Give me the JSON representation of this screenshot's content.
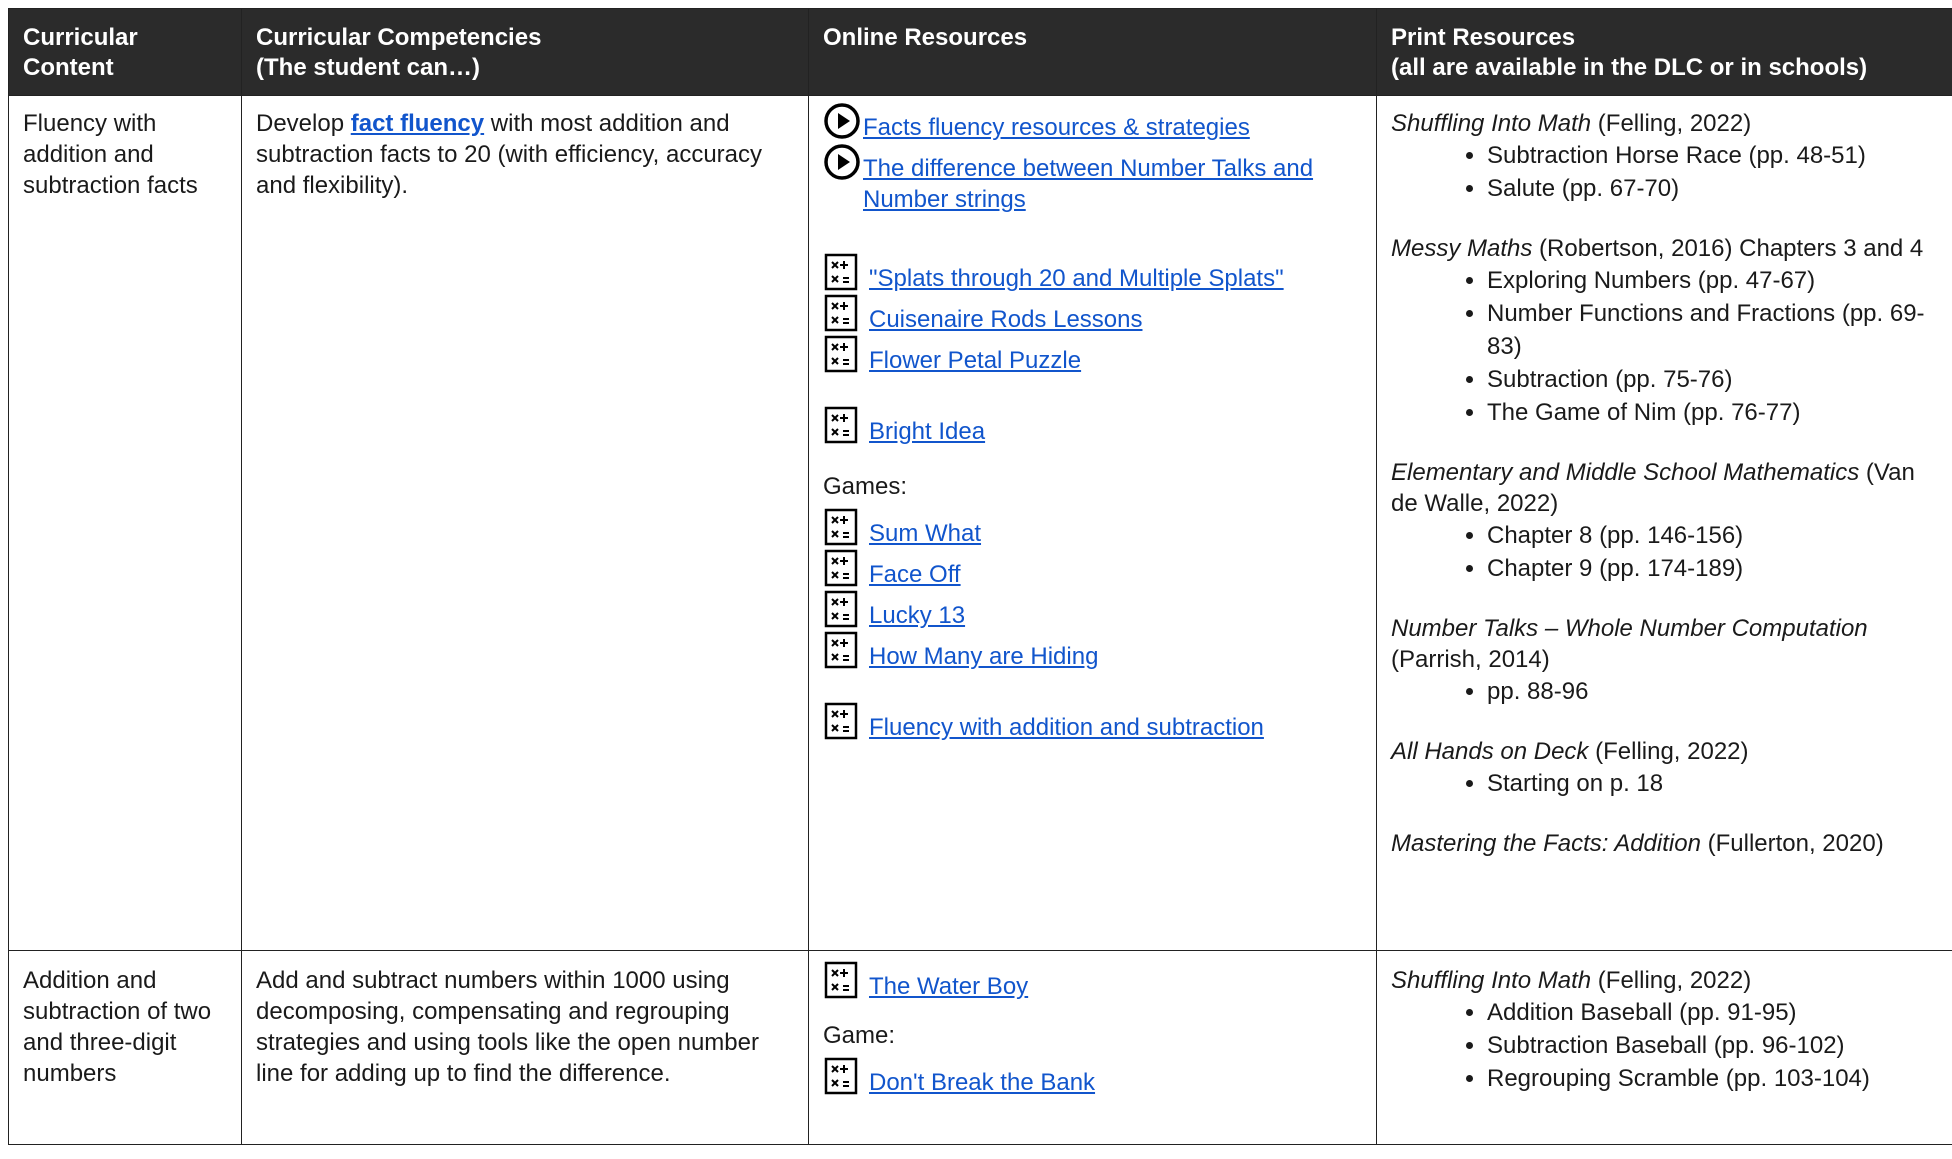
{
  "headers": {
    "content": "Curricular Content",
    "competencies": "Curricular Competencies\n (The student can…)",
    "online": "Online Resources",
    "print": "Print Resources\n (all are available in the DLC or in schools)"
  },
  "rows": [
    {
      "content": "Fluency with addition and subtraction facts",
      "competency_pre": "Develop ",
      "competency_link": "fact fluency",
      "competency_post": "  with most addition and subtraction facts to 20 (with efficiency, accuracy and flexibility).",
      "video_links": [
        "Facts fluency resources & strategies",
        "The difference between Number Talks and Number strings"
      ],
      "resource_links_a": [
        "\"Splats through 20 and Multiple Splats\"",
        "Cuisenaire Rods Lessons",
        "Flower Petal Puzzle"
      ],
      "resource_link_b": "Bright Idea",
      "games_label": "Games:",
      "game_links": [
        "Sum What",
        "Face Off",
        "Lucky 13",
        "How Many are Hiding"
      ],
      "resource_link_c": "Fluency with addition and subtraction",
      "print": [
        {
          "title": "Shuffling Into Math",
          "cite": " (Felling, 2022)",
          "items": [
            "Subtraction Horse Race (pp. 48-51)",
            "Salute (pp. 67-70)"
          ]
        },
        {
          "title": "Messy Maths",
          "cite": " (Robertson, 2016) Chapters 3 and 4",
          "items": [
            "Exploring Numbers (pp. 47-67)",
            "Number Functions and Fractions (pp. 69-83)",
            "Subtraction (pp. 75-76)",
            "The Game of Nim (pp. 76-77)"
          ]
        },
        {
          "title": "Elementary and Middle School Mathematics",
          "cite": " (Van de Walle, 2022)",
          "items": [
            "Chapter 8 (pp. 146-156)",
            "Chapter 9 (pp. 174-189)"
          ]
        },
        {
          "title": "Number Talks – Whole Number Computation",
          "cite": " (Parrish, 2014)",
          "items": [
            "pp. 88-96"
          ]
        },
        {
          "title": "All Hands on Deck",
          "cite": " (Felling, 2022)",
          "items": [
            "Starting on p. 18"
          ]
        },
        {
          "title": "Mastering the Facts: Addition",
          "cite": " (Fullerton, 2020)",
          "items": []
        }
      ]
    },
    {
      "content": "Addition and subtraction of two and three-digit numbers",
      "competency": "Add and subtract numbers within 1000 using decomposing, compensating and regrouping strategies and using tools like the open number line for adding up to find the difference.",
      "resource_link": "The Water Boy",
      "game_label": "Game:",
      "game_link": "Don't Break the Bank",
      "print": [
        {
          "title": "Shuffling Into Math",
          "cite": " (Felling, 2022)",
          "items": [
            "Addition Baseball (pp. 91-95)",
            "Subtraction Baseball (pp. 96-102)",
            "Regrouping Scramble (pp. 103-104)"
          ]
        }
      ]
    }
  ],
  "icons": {
    "video": "play-circle-icon",
    "resource": "calculator-icon"
  },
  "colors": {
    "header_bg": "#2b2b2b",
    "link": "#1155cc"
  }
}
